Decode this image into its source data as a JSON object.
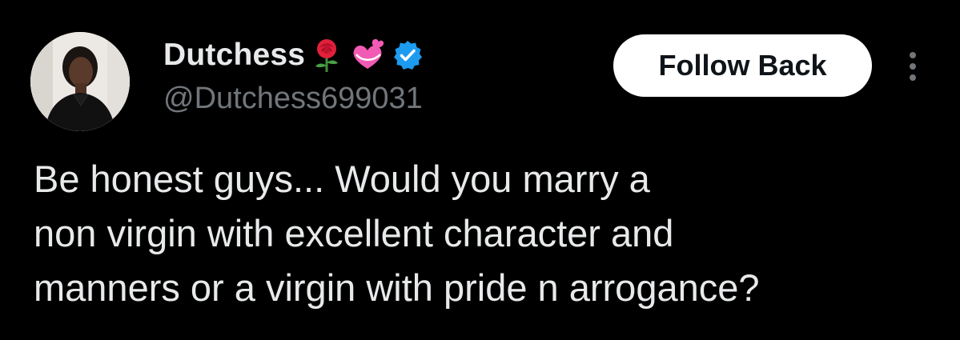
{
  "post": {
    "author": {
      "display_name": "Dutchess",
      "handle": "@Dutchess699031",
      "name_emojis": [
        "rose-emoji",
        "revolving-hearts-emoji"
      ],
      "verified_icon": "verified-badge-icon",
      "verified_color": "#1d9bf0"
    },
    "follow_label": "Follow Back",
    "more_icon": "more-options-icon",
    "text_lines": [
      "Be honest guys... Would you marry a",
      "non virgin with excellent character and",
      "manners or a virgin with pride n arrogance?"
    ]
  },
  "colors": {
    "background": "#000000",
    "primary_text": "#e7e9ea",
    "secondary_text": "#71767b",
    "button_bg": "#ffffff",
    "button_text": "#0f1419"
  }
}
